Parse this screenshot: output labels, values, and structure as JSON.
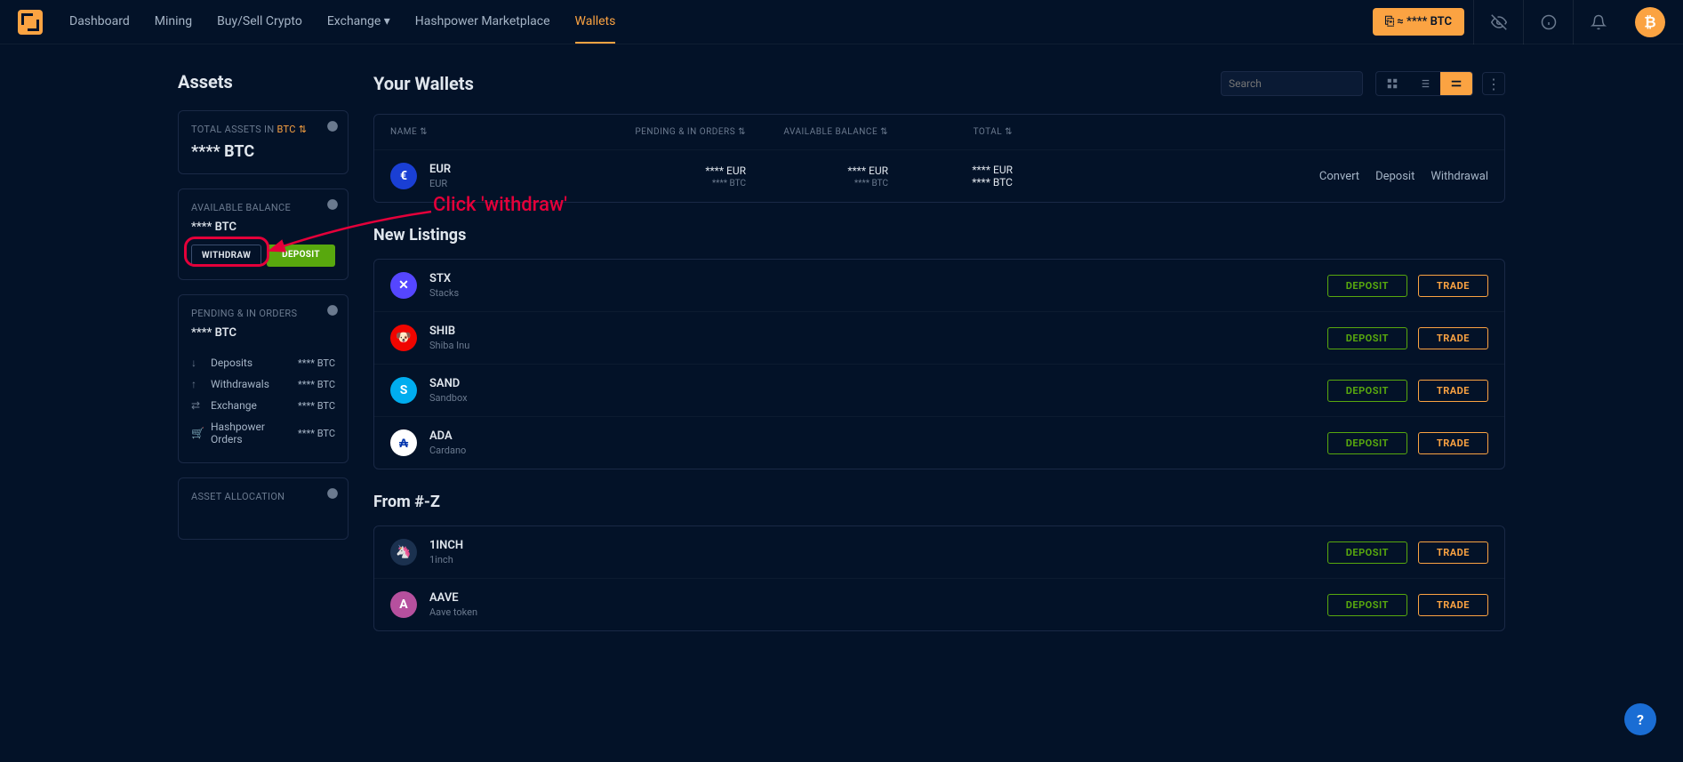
{
  "nav": {
    "items": [
      "Dashboard",
      "Mining",
      "Buy/Sell Crypto",
      "Exchange ▾",
      "Hashpower Marketplace",
      "Wallets"
    ],
    "active_index": 5,
    "btc_btn": "⎘ ≈ **** BTC"
  },
  "sidebar": {
    "title": "Assets",
    "total_label_prefix": "TOTAL ASSETS IN ",
    "total_label_currency": "BTC ⇅",
    "total_value": "**** BTC",
    "avail_label": "AVAILABLE BALANCE",
    "avail_value": "**** BTC",
    "withdraw": "WITHDRAW",
    "deposit": "DEPOSIT",
    "pending_label": "PENDING & IN ORDERS",
    "pending_value": "**** BTC",
    "rows": [
      {
        "icon": "↓",
        "label": "Deposits",
        "val": "**** BTC"
      },
      {
        "icon": "↑",
        "label": "Withdrawals",
        "val": "**** BTC"
      },
      {
        "icon": "⇄",
        "label": "Exchange",
        "val": "**** BTC"
      },
      {
        "icon": "🛒",
        "label": "Hashpower Orders",
        "val": "**** BTC"
      }
    ],
    "alloc_label": "ASSET ALLOCATION"
  },
  "main": {
    "title": "Your Wallets",
    "search_placeholder": "Search",
    "columns": {
      "name": "NAME ⇅",
      "pending": "PENDING & IN ORDERS ⇅",
      "avail": "AVAILABLE BALANCE ⇅",
      "total": "TOTAL ⇅"
    },
    "wallet_row": {
      "symbol": "EUR",
      "name": "EUR",
      "color": "#1a3fd4",
      "glyph": "€",
      "pending": "**** EUR",
      "pending_sub": "**** BTC",
      "avail": "**** EUR",
      "avail_sub": "**** BTC",
      "total": "**** EUR",
      "total_sub": "**** BTC",
      "actions": [
        "Convert",
        "Deposit",
        "Withdrawal"
      ]
    },
    "new_listings_title": "New Listings",
    "new_listings": [
      {
        "symbol": "STX",
        "name": "Stacks",
        "color": "#5546ff",
        "glyph": "✕"
      },
      {
        "symbol": "SHIB",
        "name": "Shiba Inu",
        "color": "#f00500",
        "glyph": "🐶"
      },
      {
        "symbol": "SAND",
        "name": "Sandbox",
        "color": "#00adef",
        "glyph": "S"
      },
      {
        "symbol": "ADA",
        "name": "Cardano",
        "color": "#ffffff",
        "glyph": "₳",
        "fg": "#0033ad"
      }
    ],
    "from_title": "From #-Z",
    "from_list": [
      {
        "symbol": "1INCH",
        "name": "1inch",
        "color": "#1b314f",
        "glyph": "🦄"
      },
      {
        "symbol": "AAVE",
        "name": "Aave token",
        "color": "#b6509e",
        "glyph": "A"
      }
    ],
    "deposit_btn": "DEPOSIT",
    "trade_btn": "TRADE"
  },
  "annotation": {
    "text": "Click 'withdraw'"
  },
  "help": "?"
}
